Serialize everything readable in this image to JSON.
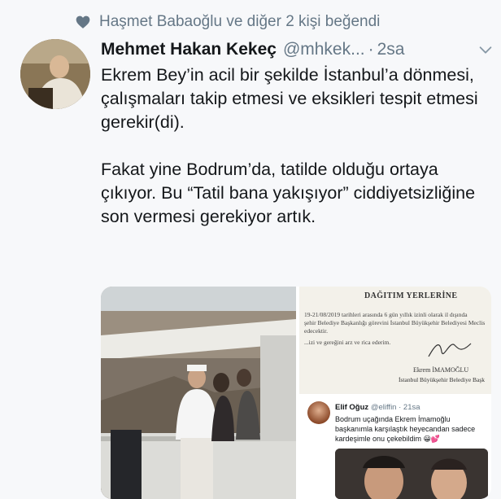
{
  "liked_by": {
    "text": "Haşmet Babaoğlu ve diğer 2 kişi beğendi",
    "icon": "heart-icon"
  },
  "tweet": {
    "author_name": "Mehmet Hakan Kekeç",
    "handle": "@mhkek...",
    "separator": "·",
    "time": "2sa",
    "paragraph_1": "Ekrem Bey’in acil bir şekilde İstanbul’a dönmesi, çalışmaları takip etmesi ve eksikleri tespit etmesi gerekir(di).",
    "paragraph_2": "Fakat yine Bodrum’da, tatilde olduğu ortaya çıkıyor. Bu “Tatil bana yakışıyor” ciddiyetsizliğine son vermesi gerekiyor artık."
  },
  "media": {
    "document": {
      "header": "DAĞITIM YERLERİNE",
      "line_1": "19-21/08/2019 tarihleri arasında 6 gün yıllık izinli olarak il dışında",
      "line_2": "şehir Belediye Başkanlığı görevini İstanbul Büyükşehir Belediyesi Meclis",
      "line_3": "edecektir.",
      "line_4": "...izi ve gereğini arz ve rica ederim.",
      "signer": "Ekrem İMAMOĞLU",
      "signer_title": "İstanbul Büyükşehir Belediye Başk"
    },
    "embedded_tweet": {
      "name": "Elif Oğuz",
      "meta": "@eliffin · 21sa",
      "text": "Bodrum uçağında Ekrem İmamoğlu başkanımla karşılaştık heyecandan sadece kardeşimle onu çekebildim 😀💕"
    }
  },
  "colors": {
    "secondary_text": "#657786",
    "primary_text": "#14171a",
    "background": "#f7f8fa"
  }
}
